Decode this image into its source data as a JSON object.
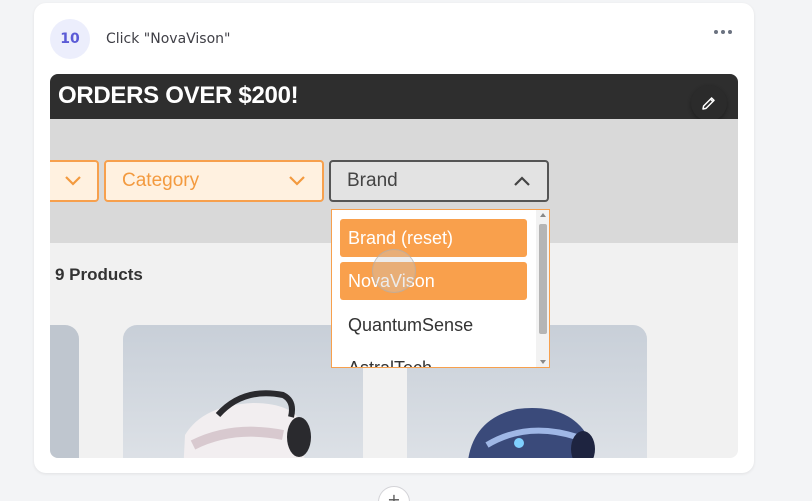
{
  "step": {
    "number": "10",
    "title": "Click \"NovaVison\""
  },
  "icons": {
    "more": "more-horizontal-icon",
    "edit": "pencil-icon",
    "chevron_down": "chevron-down-icon",
    "chevron_up": "chevron-up-icon",
    "add": "plus-icon"
  },
  "screenshot": {
    "banner_text": "ORDERS OVER $200!",
    "filters": {
      "category_label": "Category",
      "brand_label": "Brand"
    },
    "brand_options": [
      {
        "label": "Brand (reset)",
        "highlighted": true
      },
      {
        "label": "NovaVison",
        "highlighted": true
      },
      {
        "label": "QuantumSense",
        "highlighted": false
      },
      {
        "label": "AstralTech",
        "highlighted": false
      }
    ],
    "product_count": "9 Products"
  },
  "colors": {
    "accent": "#f9a04c",
    "badge_bg": "#eceefc",
    "badge_text": "#5b5bd6",
    "banner_bg": "#2e2e2e"
  },
  "add_button_label": "+"
}
